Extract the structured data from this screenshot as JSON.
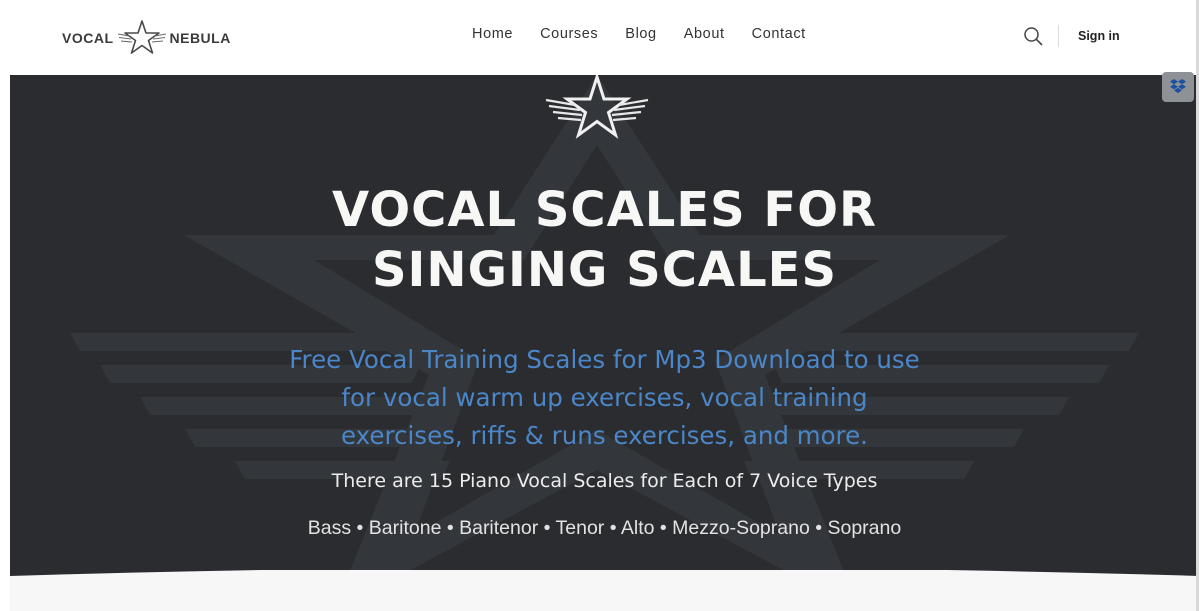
{
  "brand": {
    "left_text": "VOCAL",
    "right_text": "NEBULA"
  },
  "nav": {
    "items": [
      "Home",
      "Courses",
      "Blog",
      "About",
      "Contact"
    ],
    "signin_label": "Sign in"
  },
  "hero": {
    "title_line1": "VOCAL SCALES FOR",
    "title_line2": "SINGING SCALES",
    "subtitle_line1": "Free Vocal Training Scales for Mp3 Download to use",
    "subtitle_line2": "for vocal warm up exercises, vocal training",
    "subtitle_line3": "exercises, riffs & runs exercises, and more.",
    "info_line": "There are 15 Piano Vocal Scales for Each of 7 Voice Types",
    "voice_types": [
      "Bass",
      "Baritone",
      "Baritenor",
      "Tenor",
      "Alto",
      "Mezzo-Soprano",
      "Soprano"
    ],
    "voice_types_line": "Bass • Baritone • Baritenor • Tenor • Alto • Mezzo-Soprano • Soprano"
  },
  "colors": {
    "hero_bg": "#2b2c2f",
    "title": "#f7f7f5",
    "subtitle": "#4b86c8",
    "nav_text": "#333333"
  },
  "icons": {
    "logo": "star-wings-logo-icon",
    "search": "search-icon",
    "dropbox": "dropbox-icon"
  }
}
